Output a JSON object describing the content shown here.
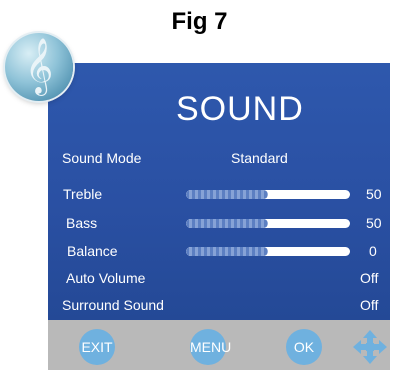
{
  "caption": "Fig 7",
  "logo": {
    "icon": "treble-clef-icon",
    "glyph": "𝄞"
  },
  "title": "SOUND",
  "sound_mode": {
    "label": "Sound Mode",
    "value": "Standard"
  },
  "settings": [
    {
      "label": "Treble",
      "value": "50",
      "level": 0.5
    },
    {
      "label": "Bass",
      "value": "50",
      "level": 0.5
    },
    {
      "label": "Balance",
      "value": "0",
      "level": 0.5
    }
  ],
  "toggles": [
    {
      "label": "Auto Volume",
      "value": "Off"
    },
    {
      "label": "Surround Sound",
      "value": "Off"
    }
  ],
  "footer": {
    "exit_label": "EXIT",
    "menu_label": "MENU",
    "ok_label": "OK",
    "nav_icon": "four-way-arrows-icon"
  },
  "colors": {
    "panel": "#2a50a3",
    "footer": "#b9b9b9",
    "button": "#6fb1df",
    "bar_fill": "#5c7fc2"
  }
}
